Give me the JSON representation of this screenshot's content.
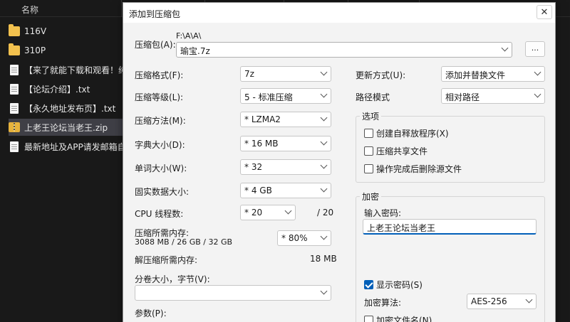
{
  "explorer": {
    "column_name": "名称",
    "files": [
      {
        "name": "116V",
        "icon": "folder-icon",
        "type": "folder"
      },
      {
        "name": "310P",
        "icon": "folder-icon",
        "type": "folder"
      },
      {
        "name": "【来了就能下载和观看！纯",
        "icon": "document-icon",
        "type": "doc"
      },
      {
        "name": "【论坛介绍】.txt",
        "icon": "document-icon",
        "type": "doc"
      },
      {
        "name": "【永久地址发布页】.txt",
        "icon": "document-icon",
        "type": "doc"
      },
      {
        "name": "上老王论坛当老王.zip",
        "icon": "zip-archive-icon",
        "type": "zip",
        "selected": true
      },
      {
        "name": "最新地址及APP请发邮箱自动",
        "icon": "document-icon",
        "type": "doc"
      }
    ]
  },
  "dialog": {
    "title": "添加到压缩包",
    "close_glyph": "✕",
    "archive": {
      "label": "压缩包(A):",
      "path": "F:\\A\\A\\",
      "name": "瑜宝.7z",
      "browse_label": "..."
    },
    "left": {
      "format": {
        "label": "压缩格式(F):",
        "value": "7z"
      },
      "level": {
        "label": "压缩等级(L):",
        "value": "5 - 标准压缩"
      },
      "method": {
        "label": "压缩方法(M):",
        "value": "* LZMA2"
      },
      "dict_size": {
        "label": "字典大小(D):",
        "value": "* 16 MB"
      },
      "word_size": {
        "label": "单词大小(W):",
        "value": "* 32"
      },
      "solid_size": {
        "label": "固实数据大小:",
        "value": "* 4 GB"
      },
      "threads": {
        "label": "CPU 线程数:",
        "value": "* 20",
        "max": "/ 20"
      },
      "memory": {
        "label": "压缩所需内存:",
        "detail": "3088 MB / 26 GB / 32 GB",
        "value": "* 80%"
      },
      "decompress_memory": {
        "label": "解压缩所需内存:",
        "value": "18 MB"
      },
      "volume": {
        "label": "分卷大小，字节(V):",
        "value": ""
      },
      "params": {
        "label": "参数(P):"
      }
    },
    "right": {
      "update_mode": {
        "label": "更新方式(U):",
        "value": "添加并替换文件"
      },
      "path_mode": {
        "label": "路径模式",
        "value": "相对路径"
      },
      "options": {
        "title": "选项",
        "items": [
          {
            "label": "创建自释放程序(X)",
            "checked": false
          },
          {
            "label": "压缩共享文件",
            "checked": false
          },
          {
            "label": "操作完成后删除源文件",
            "checked": false
          }
        ]
      },
      "encryption": {
        "title": "加密",
        "password_label": "输入密码:",
        "password_value": "上老王论坛当老王",
        "show_password": {
          "label": "显示密码(S)",
          "checked": true
        },
        "method_label": "加密算法:",
        "method_value": "AES-256",
        "encrypt_names": {
          "label": "加密文件名(N)",
          "checked": false
        }
      }
    }
  }
}
